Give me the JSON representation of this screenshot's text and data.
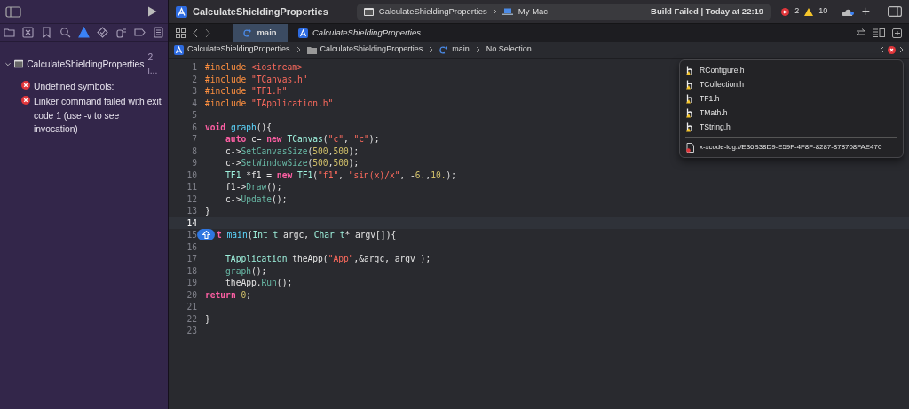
{
  "toolbar": {
    "project": "CalculateShieldingProperties",
    "scheme": "CalculateShieldingProperties",
    "destination": "My Mac",
    "status": "Build Failed | Today at 22:19",
    "errors": "2",
    "warnings": "10",
    "add": "+"
  },
  "navigator_tabs": [
    {
      "kind": "folder",
      "selected": false
    },
    {
      "kind": "source-control",
      "selected": false
    },
    {
      "kind": "bookmark",
      "selected": false
    },
    {
      "kind": "search",
      "selected": false
    },
    {
      "kind": "issues",
      "selected": true
    },
    {
      "kind": "tests",
      "selected": false
    },
    {
      "kind": "debug",
      "selected": false
    },
    {
      "kind": "breakpoints",
      "selected": false
    },
    {
      "kind": "reports",
      "selected": false
    }
  ],
  "issues": [
    {
      "title": "CalculateShieldingProperties",
      "count": "2 i...",
      "expanded": true,
      "children": [
        {
          "kind": "error",
          "text": "Undefined symbols:"
        },
        {
          "kind": "error",
          "text": "Linker command failed with exit code 1 (use -v to see invocation)"
        }
      ]
    }
  ],
  "tabs": [
    {
      "kind": "c",
      "label": "main",
      "selected": true,
      "preview": false
    },
    {
      "kind": "project",
      "label": "CalculateShieldingProperties",
      "selected": false,
      "preview": true
    }
  ],
  "breadcrumb": [
    {
      "kind": "project",
      "label": "CalculateShieldingProperties"
    },
    {
      "kind": "folder",
      "label": "CalculateShieldingProperties"
    },
    {
      "kind": "c",
      "label": "main"
    },
    {
      "kind": "plain",
      "label": "No Selection"
    }
  ],
  "editor": {
    "lines": [
      {
        "number": "1",
        "current": false,
        "indented": false,
        "badge": false,
        "tokens": [
          {
            "kind": "pre",
            "text": "#include "
          },
          {
            "kind": "str",
            "text": "<iostream>"
          }
        ]
      },
      {
        "number": "2",
        "current": false,
        "indented": false,
        "badge": false,
        "tokens": [
          {
            "kind": "pre",
            "text": "#include "
          },
          {
            "kind": "str",
            "text": "\"TCanvas.h\""
          }
        ]
      },
      {
        "number": "3",
        "current": false,
        "indented": false,
        "badge": false,
        "tokens": [
          {
            "kind": "pre",
            "text": "#include "
          },
          {
            "kind": "str",
            "text": "\"TF1.h\""
          }
        ]
      },
      {
        "number": "4",
        "current": false,
        "indented": false,
        "badge": false,
        "tokens": [
          {
            "kind": "pre",
            "text": "#include "
          },
          {
            "kind": "str",
            "text": "\"TApplication.h\""
          }
        ]
      },
      {
        "number": "5",
        "current": false,
        "badge": false
      },
      {
        "number": "6",
        "current": false,
        "indented": false,
        "badge": false,
        "tokens": [
          {
            "kind": "kw",
            "text": "void "
          },
          {
            "kind": "decl",
            "text": "graph"
          },
          {
            "kind": "plain",
            "text": "(){"
          }
        ]
      },
      {
        "number": "7",
        "current": false,
        "indented": true,
        "badge": false,
        "tokens": [
          {
            "kind": "kw",
            "text": "auto "
          },
          {
            "kind": "plain",
            "text": "c= "
          },
          {
            "kind": "kw",
            "text": "new "
          },
          {
            "kind": "type",
            "text": "TCanvas"
          },
          {
            "kind": "plain",
            "text": "("
          },
          {
            "kind": "str",
            "text": "\"c\""
          },
          {
            "kind": "plain",
            "text": ", "
          },
          {
            "kind": "str",
            "text": "\"c\""
          },
          {
            "kind": "plain",
            "text": ");"
          }
        ]
      },
      {
        "number": "8",
        "current": false,
        "indented": true,
        "badge": false,
        "tokens": [
          {
            "kind": "plain",
            "text": "c->"
          },
          {
            "kind": "call",
            "text": "SetCanvasSize"
          },
          {
            "kind": "plain",
            "text": "("
          },
          {
            "kind": "num",
            "text": "500"
          },
          {
            "kind": "plain",
            "text": ","
          },
          {
            "kind": "num",
            "text": "500"
          },
          {
            "kind": "plain",
            "text": ");"
          }
        ]
      },
      {
        "number": "9",
        "current": false,
        "indented": true,
        "badge": false,
        "tokens": [
          {
            "kind": "plain",
            "text": "c->"
          },
          {
            "kind": "call",
            "text": "SetWindowSize"
          },
          {
            "kind": "plain",
            "text": "("
          },
          {
            "kind": "num",
            "text": "500"
          },
          {
            "kind": "plain",
            "text": ","
          },
          {
            "kind": "num",
            "text": "500"
          },
          {
            "kind": "plain",
            "text": ");"
          }
        ]
      },
      {
        "number": "10",
        "current": false,
        "indented": true,
        "badge": false,
        "tokens": [
          {
            "kind": "type",
            "text": "TF1"
          },
          {
            "kind": "plain",
            "text": " *f1 = "
          },
          {
            "kind": "kw",
            "text": "new "
          },
          {
            "kind": "type",
            "text": "TF1"
          },
          {
            "kind": "plain",
            "text": "("
          },
          {
            "kind": "str",
            "text": "\"f1\""
          },
          {
            "kind": "plain",
            "text": ", "
          },
          {
            "kind": "str",
            "text": "\"sin(x)/x\""
          },
          {
            "kind": "plain",
            "text": ", -"
          },
          {
            "kind": "num",
            "text": "6."
          },
          {
            "kind": "plain",
            "text": ","
          },
          {
            "kind": "num",
            "text": "10."
          },
          {
            "kind": "plain",
            "text": ");"
          }
        ]
      },
      {
        "number": "11",
        "current": false,
        "indented": true,
        "badge": false,
        "tokens": [
          {
            "kind": "plain",
            "text": "f1->"
          },
          {
            "kind": "call",
            "text": "Draw"
          },
          {
            "kind": "plain",
            "text": "();"
          }
        ]
      },
      {
        "number": "12",
        "current": false,
        "indented": true,
        "badge": false,
        "tokens": [
          {
            "kind": "plain",
            "text": "c->"
          },
          {
            "kind": "call",
            "text": "Update"
          },
          {
            "kind": "plain",
            "text": "();"
          }
        ]
      },
      {
        "number": "13",
        "current": false,
        "indented": false,
        "badge": false,
        "tokens": [
          {
            "kind": "plain",
            "text": "}"
          }
        ]
      },
      {
        "number": "14",
        "current": true,
        "indented": false,
        "badge": false
      },
      {
        "number": "15",
        "current": false,
        "indented": false,
        "badge": true,
        "tokens": [
          {
            "kind": "kw",
            "text": "t "
          },
          {
            "kind": "decl",
            "text": "main"
          },
          {
            "kind": "plain",
            "text": "("
          },
          {
            "kind": "type",
            "text": "Int_t"
          },
          {
            "kind": "plain",
            "text": " argc, "
          },
          {
            "kind": "type",
            "text": "Char_t"
          },
          {
            "kind": "plain",
            "text": "* argv[]){"
          }
        ]
      },
      {
        "number": "16",
        "current": false,
        "badge": false
      },
      {
        "number": "17",
        "current": false,
        "indented": true,
        "badge": false,
        "tokens": [
          {
            "kind": "type",
            "text": "TApplication"
          },
          {
            "kind": "plain",
            "text": " theApp("
          },
          {
            "kind": "str",
            "text": "\"App\""
          },
          {
            "kind": "plain",
            "text": ",&argc, argv );"
          }
        ]
      },
      {
        "number": "18",
        "current": false,
        "indented": true,
        "badge": false,
        "tokens": [
          {
            "kind": "call",
            "text": "graph"
          },
          {
            "kind": "plain",
            "text": "();"
          }
        ]
      },
      {
        "number": "19",
        "current": false,
        "indented": true,
        "badge": false,
        "tokens": [
          {
            "kind": "plain",
            "text": "theApp."
          },
          {
            "kind": "call",
            "text": "Run"
          },
          {
            "kind": "plain",
            "text": "();"
          }
        ]
      },
      {
        "number": "20",
        "current": false,
        "indented": false,
        "badge": false,
        "tokens": [
          {
            "kind": "kw",
            "text": "return "
          },
          {
            "kind": "num",
            "text": "0"
          },
          {
            "kind": "plain",
            "text": ";"
          }
        ]
      },
      {
        "number": "21",
        "current": false,
        "badge": false
      },
      {
        "number": "22",
        "current": false,
        "indented": false,
        "badge": false,
        "tokens": [
          {
            "kind": "plain",
            "text": "}"
          }
        ]
      },
      {
        "number": "23",
        "current": false,
        "badge": false
      }
    ]
  },
  "popup": {
    "items": [
      {
        "kind": "header",
        "label": "RConfigure.h"
      },
      {
        "kind": "header",
        "label": "TCollection.h"
      },
      {
        "kind": "header",
        "label": "TF1.h"
      },
      {
        "kind": "header",
        "label": "TMath.h"
      },
      {
        "kind": "header",
        "label": "TString.h"
      },
      {
        "kind": "log",
        "label": "x-xcode-log://E36B38D9-E59F-4F8F-8287-878708FAE470"
      }
    ]
  }
}
